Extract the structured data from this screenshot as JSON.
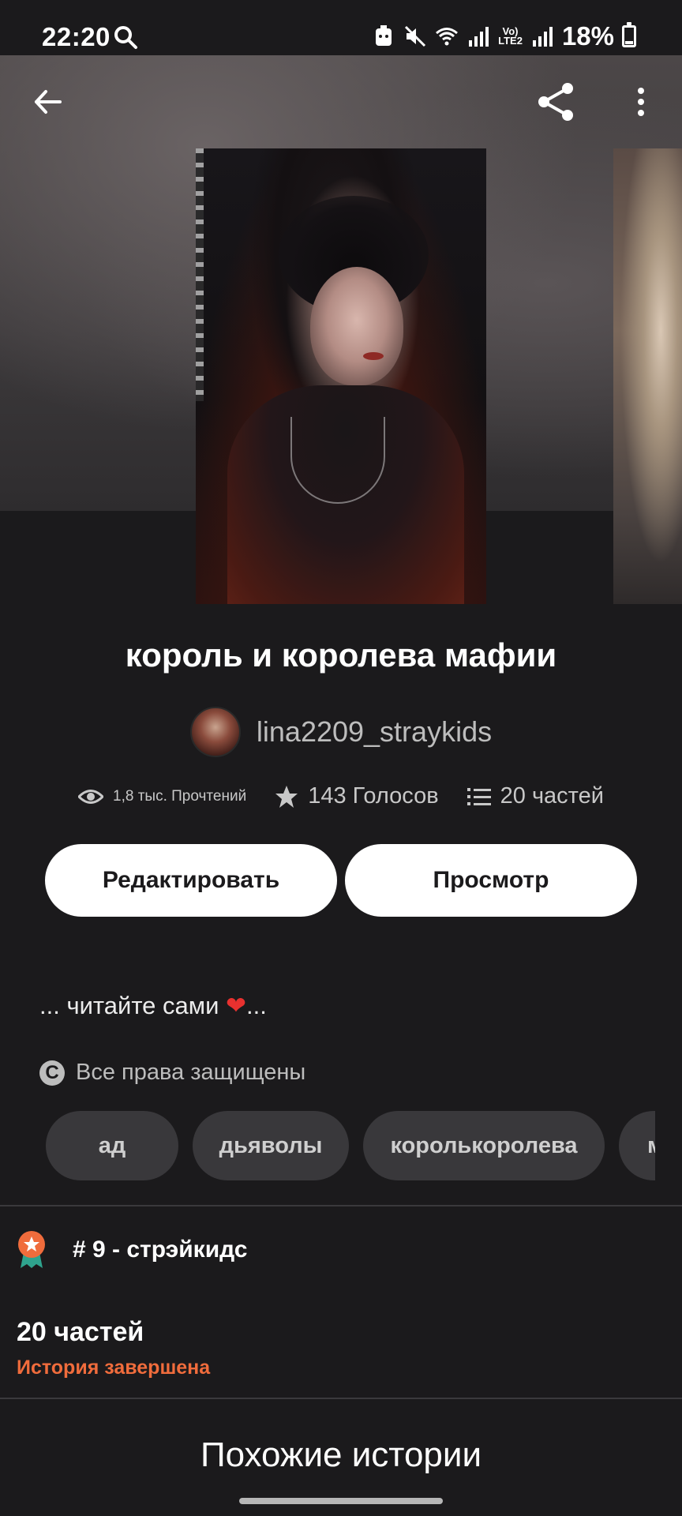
{
  "status_bar": {
    "time": "22:20",
    "volte": "Vo)",
    "lte": "LTE2",
    "battery": "18%"
  },
  "header": {
    "back_icon": "arrow-left-icon",
    "share_icon": "share-icon",
    "more_icon": "more-vertical-icon"
  },
  "story": {
    "title": "король и королева мафии",
    "author": "lina2209_straykids",
    "reads": "1,8 тыс. Прочтений",
    "votes": "143 Голосов",
    "parts": "20 частей",
    "description": "... читайте сами",
    "description_suffix": "...",
    "heart": "❤",
    "copyright": "Все права защищены",
    "copyright_symbol": "C"
  },
  "actions": {
    "edit_label": "Редактировать",
    "view_label": "Просмотр"
  },
  "tags": [
    "ад",
    "дьяволы",
    "королькоролева",
    "м"
  ],
  "ranking": {
    "text": "# 9 - стрэйкидс"
  },
  "parts_info": {
    "count": "20 частей",
    "status": "История завершена"
  },
  "similar": {
    "heading": "Похожие истории"
  },
  "colors": {
    "background": "#1b1a1c",
    "accent_orange": "#f06c3c",
    "button_bg": "#ffffff",
    "tag_bg": "#39383b"
  }
}
